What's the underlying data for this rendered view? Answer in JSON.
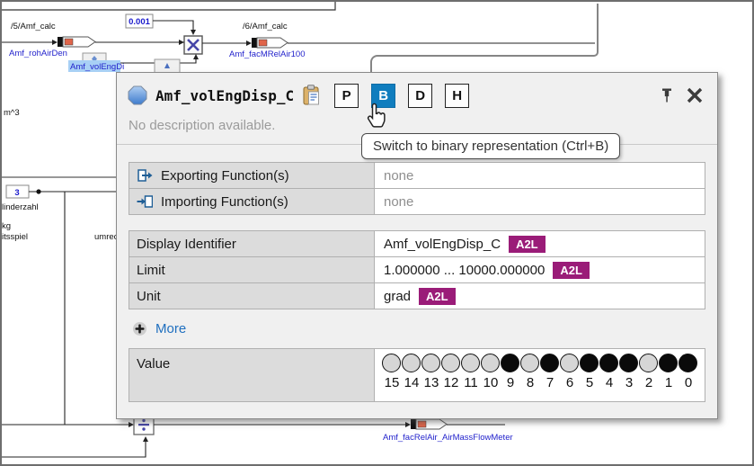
{
  "canvas": {
    "labels": {
      "sys5": "/5/Amf_calc",
      "sys6": "/6/Amf_calc",
      "const1": "0.001",
      "const3": "3",
      "sig_rohAirDen": "Amf_rohAirDen",
      "sig_facMRelAir": "Amf_facMRelAir100",
      "sig_volEngDisp": "Amf_volEngDi",
      "sig_facRelAir": "Amf_facRelAir_AirMassFlowMeter",
      "txt_m3": "m^3",
      "txt_zylinderzahl": "linderzahl",
      "txt_kg": "kg",
      "txt_arbeitsspiel": "itsspiel",
      "txt_umrechnen": "umrechn"
    }
  },
  "popup": {
    "title": "Amf_volEngDisp_C",
    "description": "No description available.",
    "format_buttons": {
      "p": "P",
      "b": "B",
      "d": "D",
      "h": "H"
    },
    "tooltip": "Switch to binary representation (Ctrl+B)",
    "functions_rows": [
      {
        "label": "Exporting Function(s)",
        "value": "none"
      },
      {
        "label": "Importing Function(s)",
        "value": "none"
      }
    ],
    "property_rows": [
      {
        "label": "Display Identifier",
        "value": "Amf_volEngDisp_C",
        "badge": "A2L"
      },
      {
        "label": "Limit",
        "value": "1.000000 ... 10000.000000",
        "badge": "A2L"
      },
      {
        "label": "Unit",
        "value": "grad",
        "badge": "A2L"
      }
    ],
    "more_label": "More",
    "value_row": {
      "label": "Value",
      "bits": [
        0,
        0,
        0,
        0,
        0,
        0,
        1,
        0,
        1,
        0,
        1,
        1,
        1,
        0,
        1,
        1
      ],
      "bit_numbers": [
        "15",
        "14",
        "13",
        "12",
        "11",
        "10",
        "9",
        "8",
        "7",
        "6",
        "5",
        "4",
        "3",
        "2",
        "1",
        "0"
      ]
    },
    "colors": {
      "accent_blue": "#107dbe",
      "badge_purple": "#9a1c78",
      "link_blue": "#1f6fbf"
    }
  }
}
